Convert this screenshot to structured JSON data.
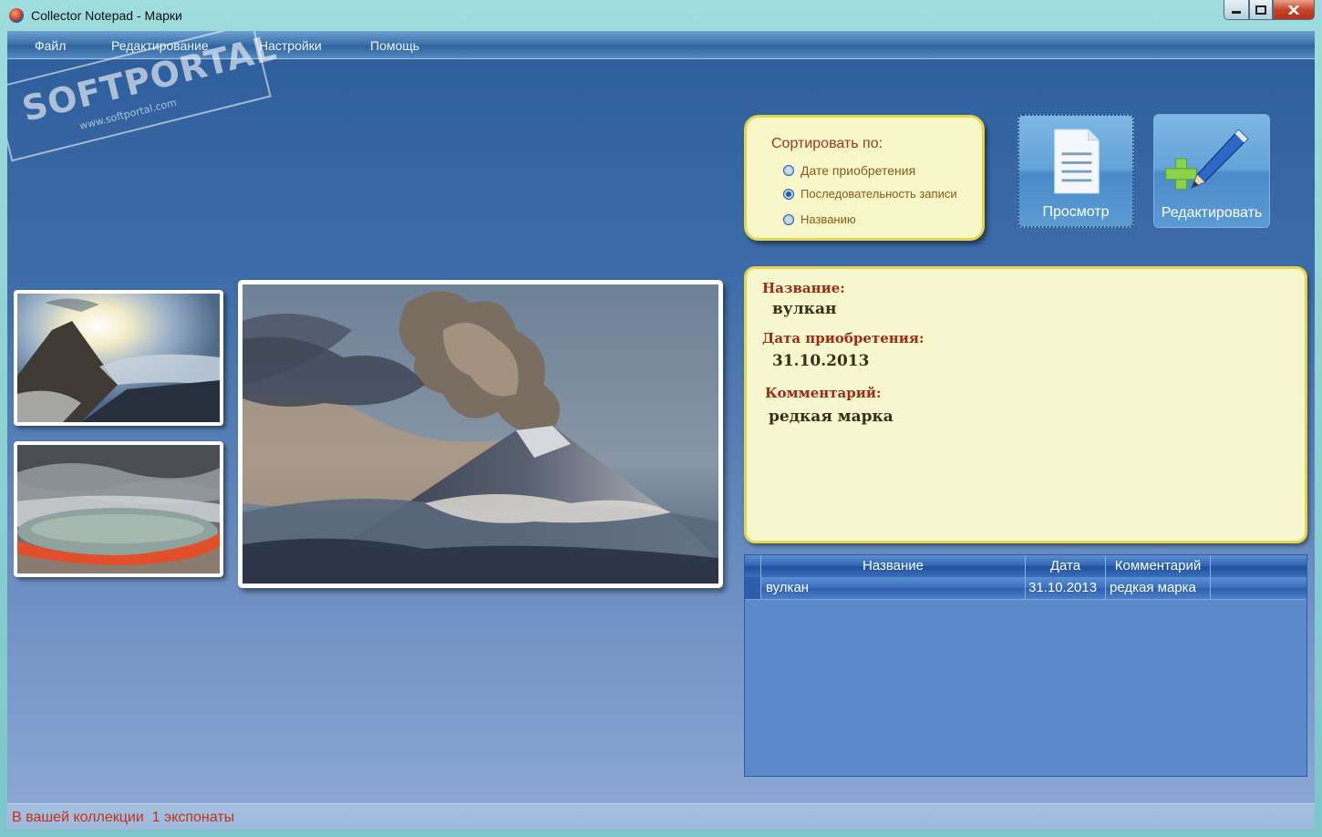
{
  "window": {
    "title": "Collector Notepad - Марки"
  },
  "menu": [
    {
      "label": "Файл"
    },
    {
      "label": "Редактирование"
    },
    {
      "label": "Настройки"
    },
    {
      "label": "Помощь"
    }
  ],
  "watermark": {
    "brand": "SOFTPORTAL",
    "url": "www.softportal.com"
  },
  "sort": {
    "title": "Сортировать по:",
    "options": [
      {
        "label": "Дате приобретения",
        "checked": false
      },
      {
        "label": "Последовательность записи",
        "checked": true
      },
      {
        "label": "Названию",
        "checked": false
      }
    ]
  },
  "buttons": {
    "view_label": "Просмотр",
    "edit_label": "Редактировать"
  },
  "details": {
    "name_label": "Название:",
    "name_value": "вулкан",
    "date_label": "Дата приобретения:",
    "date_value": "31.10.2013",
    "comment_label": "Комментарий:",
    "comment_value": "редкая марка"
  },
  "table": {
    "columns": [
      "Название",
      "Дата",
      "Комментарий"
    ],
    "rows": [
      {
        "name": "вулкан",
        "date": "31.10.2013",
        "comment": "редкая марка"
      }
    ]
  },
  "status": {
    "text": "В вашей коллекции  1 экспонаты"
  },
  "colors": {
    "accent_red": "#c0331a",
    "panel_yellow": "#f7f7cf",
    "panel_border": "#e4d64b"
  }
}
